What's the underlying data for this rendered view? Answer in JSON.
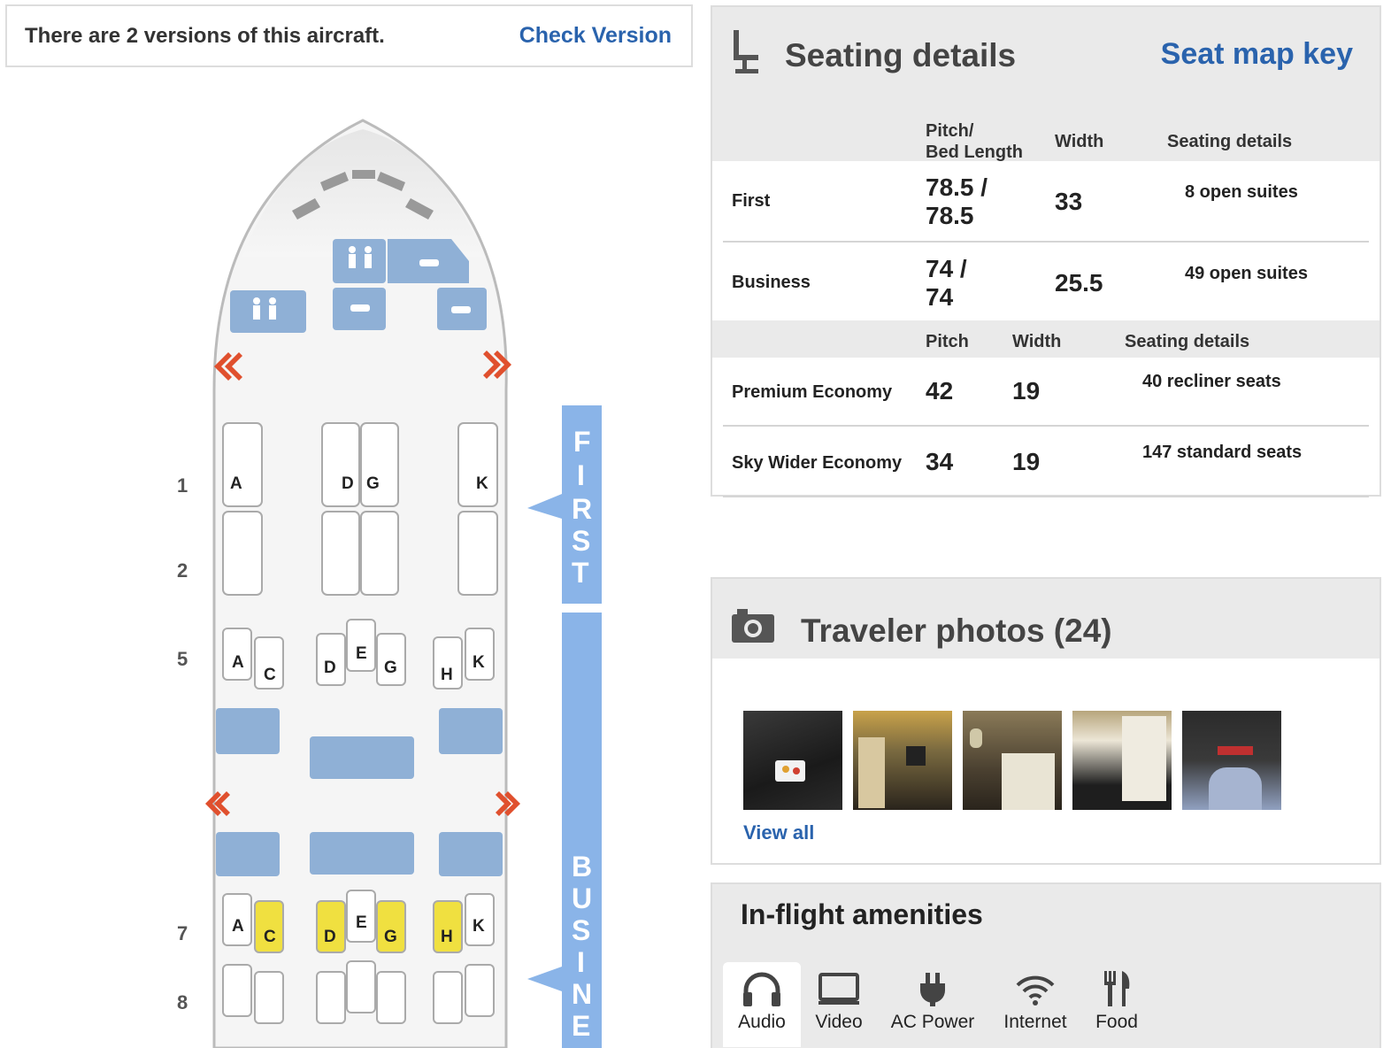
{
  "banner": {
    "text": "There are 2 versions of this aircraft.",
    "link": "Check Version"
  },
  "seatmap": {
    "rows": [
      "1",
      "2",
      "5",
      "7",
      "8"
    ],
    "first_row_seats": [
      "A",
      "D",
      "G",
      "K"
    ],
    "biz_row_seats": [
      "A",
      "C",
      "D",
      "E",
      "G",
      "H",
      "K"
    ],
    "cabins": {
      "first": [
        "F",
        "I",
        "R",
        "S",
        "T"
      ],
      "business": [
        "B",
        "U",
        "S",
        "I",
        "N",
        "E"
      ]
    },
    "colors": {
      "panel": "#8fb0d6",
      "fuselage": "#f4f4f4",
      "exit": "#e0502e",
      "highlight": "#f0e040",
      "cabin_tab": "#8ab4e8"
    }
  },
  "seating": {
    "title": "Seating details",
    "key_link": "Seat map key",
    "header1": {
      "pitch": "Pitch/\nBed Length",
      "width": "Width",
      "details": "Seating details"
    },
    "header2": {
      "pitch": "Pitch",
      "width": "Width",
      "details": "Seating details"
    },
    "rows": [
      {
        "class": "First",
        "pitch": "78.5 /\n78.5",
        "width": "33",
        "details": "8 open suites"
      },
      {
        "class": "Business",
        "pitch": "74 /\n74",
        "width": "25.5",
        "details": "49 open suites"
      },
      {
        "class": "Premium Economy",
        "pitch": "42",
        "width": "19",
        "details": "40 recliner seats"
      },
      {
        "class": "Sky Wider Economy",
        "pitch": "34",
        "width": "19",
        "details": "147 standard seats"
      }
    ]
  },
  "photos": {
    "title": "Traveler photos (24)",
    "view_all": "View all"
  },
  "amenities": {
    "title": "In-flight amenities",
    "tabs": [
      {
        "label": "Audio",
        "icon": "headphones-icon"
      },
      {
        "label": "Video",
        "icon": "monitor-icon"
      },
      {
        "label": "AC Power",
        "icon": "plug-icon"
      },
      {
        "label": "Internet",
        "icon": "wifi-icon"
      },
      {
        "label": "Food",
        "icon": "fork-knife-icon"
      }
    ]
  }
}
